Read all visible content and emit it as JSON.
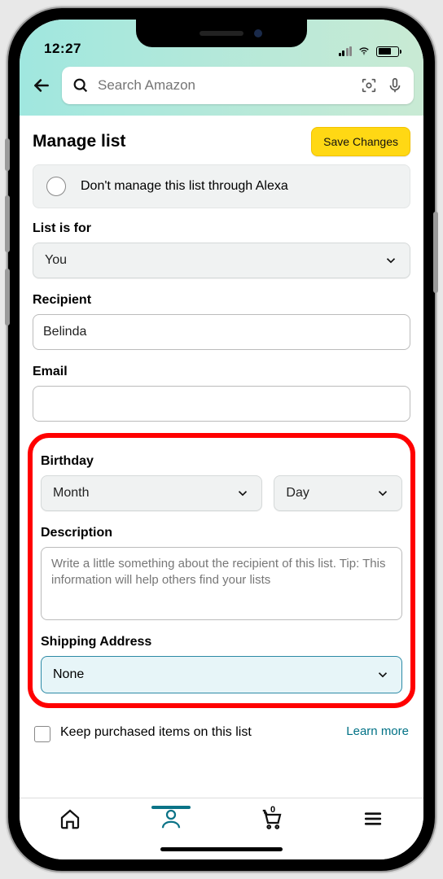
{
  "status": {
    "time": "12:27"
  },
  "header": {
    "search_placeholder": "Search Amazon"
  },
  "page": {
    "title": "Manage list",
    "save_label": "Save Changes"
  },
  "alexa": {
    "text": "Don't manage this list through Alexa"
  },
  "fields": {
    "list_for_label": "List is for",
    "list_for_value": "You",
    "recipient_label": "Recipient",
    "recipient_value": "Belinda",
    "email_label": "Email",
    "email_value": "",
    "birthday_label": "Birthday",
    "birthday_month": "Month",
    "birthday_day": "Day",
    "description_label": "Description",
    "description_placeholder": "Write a little something about the recipient of this list. Tip: This information will help others find your lists",
    "shipping_label": "Shipping Address",
    "shipping_value": "None"
  },
  "keep": {
    "text": "Keep purchased items on this list",
    "learn_more": "Learn more"
  },
  "tabs": {
    "cart_count": "0"
  }
}
